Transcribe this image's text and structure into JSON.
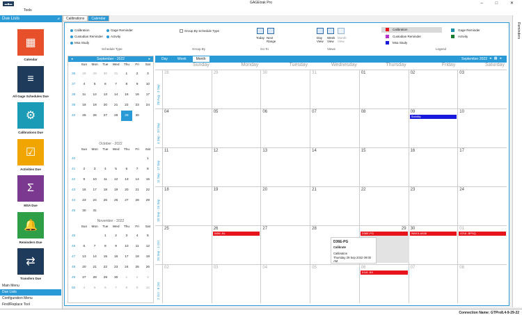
{
  "window": {
    "title": "GAGEtrak Pro"
  },
  "menu": {
    "tools": "Tools"
  },
  "left_panel": {
    "header": "Due Lists",
    "items": [
      {
        "label": "Calendar",
        "icon": "calendar-icon",
        "color": "#e8502b"
      },
      {
        "label": "All Gage Schedules Due",
        "icon": "schedules-icon",
        "color": "#1f3b5c"
      },
      {
        "label": "Calibrations Due",
        "icon": "calibration-icon",
        "color": "#1b9bb5"
      },
      {
        "label": "Activities Due",
        "icon": "activities-icon",
        "color": "#f0a500"
      },
      {
        "label": "MSA Due",
        "icon": "msa-icon",
        "color": "#7b3a8f"
      },
      {
        "label": "Reminders Due",
        "icon": "reminders-icon",
        "color": "#2e9e47"
      },
      {
        "label": "Transfers Due",
        "icon": "transfers-icon",
        "color": "#1f3b5c"
      }
    ],
    "bottom_nav": [
      "Main Menu",
      "Due Lists",
      "Configuration Menu",
      "Find/Replace Tool"
    ]
  },
  "tabs": [
    {
      "label": "Calibrations"
    },
    {
      "label": "Calendar"
    }
  ],
  "ribbon": {
    "schedule_type": {
      "label": "Schedule Type",
      "options": [
        {
          "label": "Calibration",
          "color": "#2a9ad6"
        },
        {
          "label": "Gage Reminder",
          "color": "#2a9ad6"
        },
        {
          "label": "Custodian Reminder",
          "color": "#2a9ad6"
        },
        {
          "label": "Activity",
          "color": "#2a9ad6"
        },
        {
          "label": "Msa Study",
          "color": "#2a9ad6"
        }
      ]
    },
    "group_by": {
      "label": "Group By",
      "checkbox": "Group By Schedule Type"
    },
    "go_to": {
      "label": "Go To",
      "today": "Today",
      "next_range": "Next Range"
    },
    "views": {
      "label": "Views",
      "day": "Day View",
      "week": "Week View",
      "month": "Month View"
    },
    "legend": {
      "label": "Legend",
      "items": [
        {
          "label": "Calibration",
          "color": "#e8141c"
        },
        {
          "label": "Gage Reminder",
          "color": "#1f8fa8"
        },
        {
          "label": "Custodian Reminder",
          "color": "#b333c9"
        },
        {
          "label": "Activity",
          "color": "#1a7a2e"
        },
        {
          "label": "Msa Study",
          "color": "#1a1adc"
        }
      ]
    }
  },
  "mini_calendar": {
    "header": "September - 2022",
    "dow": [
      "Sun",
      "Mon",
      "Tue",
      "Wed",
      "Thu",
      "Fri",
      "Sat"
    ],
    "months": [
      {
        "title": "September - 2022",
        "weeks": [
          {
            "wk": "36",
            "days": [
              "28",
              "29",
              "30",
              "31",
              "1",
              "2",
              "3"
            ]
          },
          {
            "wk": "37",
            "days": [
              "4",
              "5",
              "6",
              "7",
              "8",
              "9",
              "10"
            ]
          },
          {
            "wk": "38",
            "days": [
              "11",
              "12",
              "13",
              "14",
              "15",
              "16",
              "17"
            ]
          },
          {
            "wk": "39",
            "days": [
              "18",
              "19",
              "20",
              "21",
              "22",
              "23",
              "24"
            ]
          },
          {
            "wk": "40",
            "days": [
              "25",
              "26",
              "27",
              "28",
              "29",
              "30",
              ""
            ]
          }
        ]
      },
      {
        "title": "October - 2022",
        "weeks": [
          {
            "wk": "40",
            "days": [
              "",
              "",
              "",
              "",
              "",
              "",
              "1"
            ]
          },
          {
            "wk": "41",
            "days": [
              "2",
              "3",
              "4",
              "5",
              "6",
              "7",
              "8"
            ]
          },
          {
            "wk": "42",
            "days": [
              "9",
              "10",
              "11",
              "12",
              "13",
              "14",
              "15"
            ]
          },
          {
            "wk": "43",
            "days": [
              "16",
              "17",
              "18",
              "19",
              "20",
              "21",
              "22"
            ]
          },
          {
            "wk": "44",
            "days": [
              "23",
              "24",
              "25",
              "26",
              "27",
              "28",
              "29"
            ]
          },
          {
            "wk": "45",
            "days": [
              "30",
              "31",
              "",
              "",
              "",
              "",
              ""
            ]
          }
        ]
      },
      {
        "title": "November - 2022",
        "weeks": [
          {
            "wk": "45",
            "days": [
              "",
              "",
              "1",
              "2",
              "3",
              "4",
              "5"
            ]
          },
          {
            "wk": "46",
            "days": [
              "6",
              "7",
              "8",
              "9",
              "10",
              "11",
              "12"
            ]
          },
          {
            "wk": "47",
            "days": [
              "13",
              "14",
              "15",
              "16",
              "17",
              "18",
              "19"
            ]
          },
          {
            "wk": "48",
            "days": [
              "20",
              "21",
              "22",
              "23",
              "24",
              "25",
              "26"
            ]
          },
          {
            "wk": "49",
            "days": [
              "27",
              "28",
              "29",
              "30",
              "1",
              "2",
              "3"
            ]
          },
          {
            "wk": "50",
            "days": [
              "4",
              "5",
              "6",
              "7",
              "8",
              "9",
              "10"
            ]
          }
        ]
      }
    ]
  },
  "big_calendar": {
    "views": [
      "Day",
      "Week",
      "Month"
    ],
    "current_view": "Month",
    "range_label": "September 2022",
    "dow": [
      "Sunday",
      "Monday",
      "Tuesday",
      "Wednesday",
      "Thursday",
      "Friday",
      "Saturday"
    ],
    "weeks": [
      {
        "label": "28 Aug - 3 Sep",
        "days": [
          "28",
          "29",
          "30",
          "31",
          "01",
          "02",
          "03"
        ]
      },
      {
        "label": "4 Sep - 10 Sep",
        "days": [
          "04",
          "05",
          "06",
          "07",
          "08",
          "09",
          "10"
        ]
      },
      {
        "label": "11 Sep - 17 Sep",
        "days": [
          "11",
          "12",
          "13",
          "14",
          "15",
          "16",
          "17"
        ]
      },
      {
        "label": "18 Sep - 24 Sep",
        "days": [
          "18",
          "19",
          "20",
          "21",
          "22",
          "23",
          "24"
        ]
      },
      {
        "label": "25 Sep - 1 Oct",
        "days": [
          "25",
          "26",
          "27",
          "28",
          "29",
          "30",
          "01"
        ]
      },
      {
        "label": "2 Oct - 8 Oct",
        "days": [
          "02",
          "03",
          "04",
          "05",
          "06",
          "07",
          "08"
        ]
      }
    ],
    "events": [
      {
        "week": 1,
        "day": 5,
        "label": "Stability",
        "color": "#1a1adc"
      },
      {
        "week": 4,
        "day": 1,
        "label": "0456 -BL",
        "color": "#e8141c"
      },
      {
        "week": 4,
        "day": 4,
        "label": "D36E-PG",
        "color": "#e8141c"
      },
      {
        "week": 4,
        "day": 5,
        "label": "0M401-6638",
        "color": "#e8141c"
      },
      {
        "week": 4,
        "day": 6,
        "label": "0218 -BPSQ",
        "color": "#e8141c"
      },
      {
        "week": 5,
        "day": 4,
        "label": "0116 -BX",
        "color": "#e8141c"
      }
    ]
  },
  "tooltip": {
    "title": "D36E-PG",
    "subtitle": "Calibrate",
    "type": "Calibration",
    "date": "Thursday 29 Sep 2022 09:00 AM"
  },
  "right_panel": {
    "label": "Reminders"
  },
  "status": {
    "connection": "Connection Name: GTPro8.4-9-29-22"
  }
}
